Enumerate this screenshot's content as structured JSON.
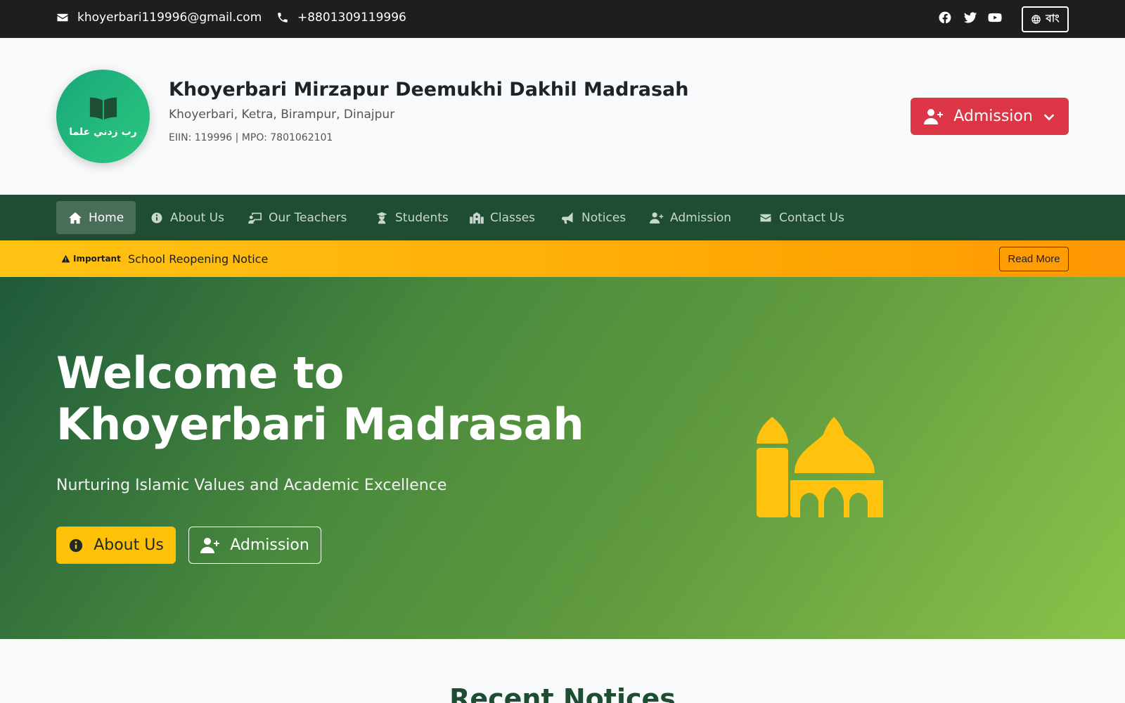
{
  "topbar": {
    "email": "khoyerbari119996@gmail.com",
    "phone": "+8801309119996",
    "social": [
      "facebook-icon",
      "twitter-icon",
      "youtube-icon"
    ],
    "lang_label": "বাং"
  },
  "header": {
    "motto": "رب زدني علما",
    "name": "Khoyerbari Mirzapur Deemukhi Dakhil Madrasah",
    "address": "Khoyerbari, Ketra, Birampur, Dinajpur",
    "eiin": "EIIN: 119996 | MPO: 7801062101",
    "admission_label": "Admission"
  },
  "nav": {
    "items": [
      {
        "label": "Home",
        "icon": "home-icon"
      },
      {
        "label": "About Us",
        "icon": "info-icon"
      },
      {
        "label": "Our Teachers",
        "icon": "teacher-icon"
      },
      {
        "label": "Students",
        "icon": "student-icon"
      },
      {
        "label": "Classes",
        "icon": "school-icon"
      },
      {
        "label": "Notices",
        "icon": "bullhorn-icon"
      },
      {
        "label": "Admission",
        "icon": "user-plus-icon"
      },
      {
        "label": "Contact Us",
        "icon": "envelope-icon"
      }
    ],
    "active_index": 0
  },
  "notice": {
    "badge": "Important",
    "text": "School Reopening Notice",
    "read_more": "Read More"
  },
  "hero": {
    "title_line1": "Welcome to",
    "title_line2": "Khoyerbari Madrasah",
    "tagline": "Nurturing Islamic Values and Academic Excellence",
    "btn_about": "About Us",
    "btn_admission": "Admission",
    "illustration": "mosque-icon"
  },
  "section": {
    "recent_notices_title": "Recent Notices"
  },
  "colors": {
    "topbar_bg": "#1c1e20",
    "nav_bg": "#1f4d33",
    "accent_red": "#dc3545",
    "accent_yellow": "#ffc107",
    "notice_orange": "#ffa203",
    "logo_green": "#1aa77a"
  }
}
